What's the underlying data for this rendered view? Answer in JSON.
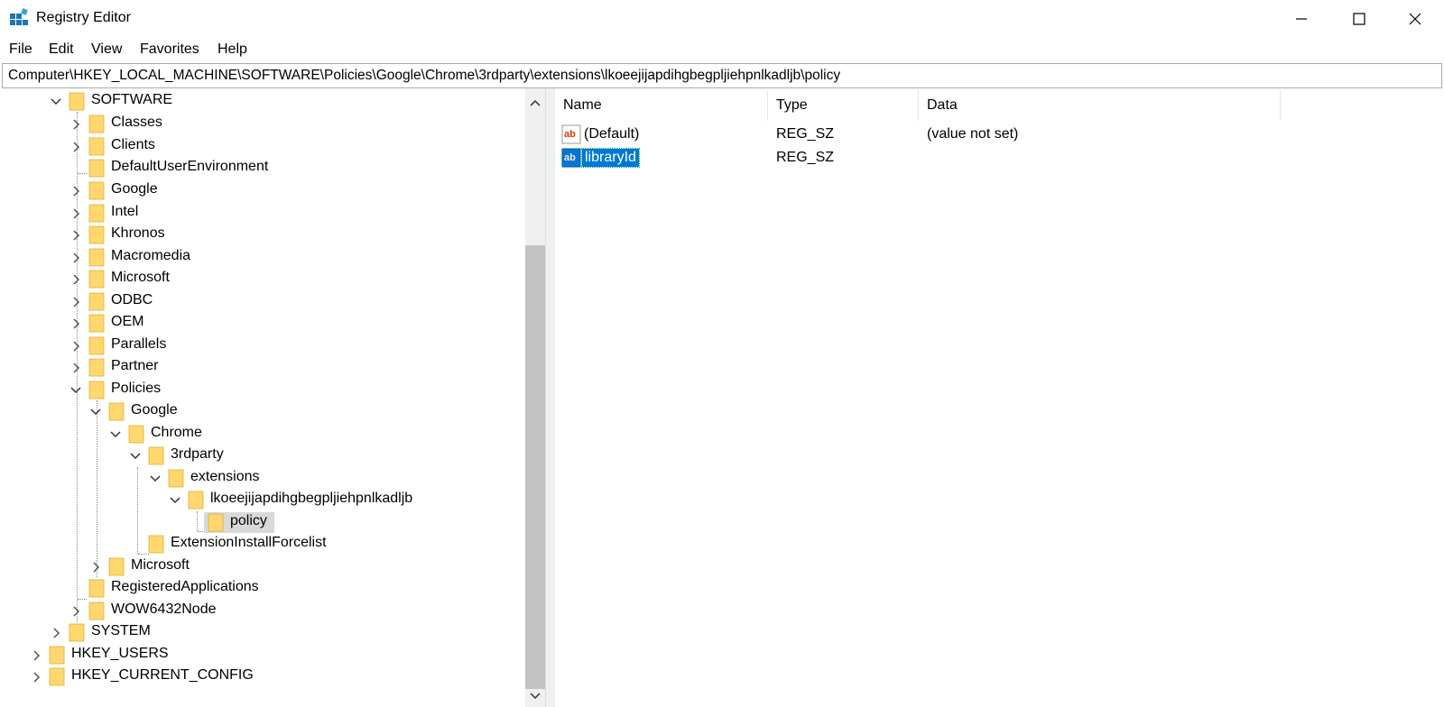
{
  "window": {
    "title": "Registry Editor",
    "controls": {
      "minimize": "minimize-icon",
      "maximize": "maximize-icon",
      "close": "close-icon"
    }
  },
  "menu": [
    "File",
    "Edit",
    "View",
    "Favorites",
    "Help"
  ],
  "address": "Computer\\HKEY_LOCAL_MACHINE\\SOFTWARE\\Policies\\Google\\Chrome\\3rdparty\\extensions\\lkoeejijapdihgbegpljiehpnlkadljb\\policy",
  "tree": [
    "SOFTWARE",
    "Classes",
    "Clients",
    "DefaultUserEnvironment",
    "Google",
    "Intel",
    "Khronos",
    "Macromedia",
    "Microsoft",
    "ODBC",
    "OEM",
    "Parallels",
    "Partner",
    "Policies",
    "Google",
    "Chrome",
    "3rdparty",
    "extensions",
    "lkoeejijapdihgbegpljiehpnlkadljb",
    "policy",
    "ExtensionInstallForcelist",
    "Microsoft",
    "RegisteredApplications",
    "WOW6432Node",
    "SYSTEM",
    "HKEY_USERS",
    "HKEY_CURRENT_CONFIG"
  ],
  "columns": {
    "name": "Name",
    "type": "Type",
    "data": "Data"
  },
  "values": [
    {
      "name": "(Default)",
      "type": "REG_SZ",
      "data": "(value not set)"
    },
    {
      "name": "libraryId",
      "type": "REG_SZ",
      "data": ""
    }
  ],
  "colors": {
    "selection": "#0078d7",
    "folder": "#ffd76e",
    "tree_selected": "#d9d9d9",
    "string_icon": "#d83b01"
  }
}
